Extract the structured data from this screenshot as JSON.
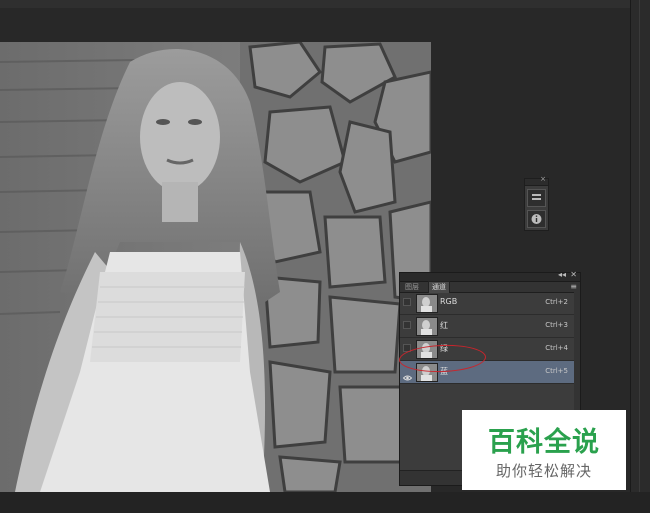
{
  "channels_panel": {
    "tabs": [
      "图层",
      "通道"
    ],
    "channels": [
      {
        "name": "RGB",
        "shortcut": "Ctrl+2",
        "visible": false,
        "selected": false
      },
      {
        "name": "红",
        "shortcut": "Ctrl+3",
        "visible": false,
        "selected": false
      },
      {
        "name": "绿",
        "shortcut": "Ctrl+4",
        "visible": false,
        "selected": false
      },
      {
        "name": "蓝",
        "shortcut": "Ctrl+5",
        "visible": true,
        "selected": true
      }
    ],
    "menu_glyph": "≡",
    "collapse_glyph": "◂◂",
    "close_glyph": "✕"
  },
  "mini_panel": {
    "icons": [
      "properties-icon",
      "info-icon"
    ]
  },
  "watermark": {
    "title": "百科全说",
    "subtitle": "助你轻松解决",
    "color": "#2aa14d"
  },
  "colors": {
    "workspace": "#282828",
    "panel": "#3c3c3c",
    "selection": "#5d6b80",
    "annotation": "#c8252c"
  },
  "icons": {
    "eye": "eye-icon",
    "panel_menu": "panel-menu-icon"
  }
}
